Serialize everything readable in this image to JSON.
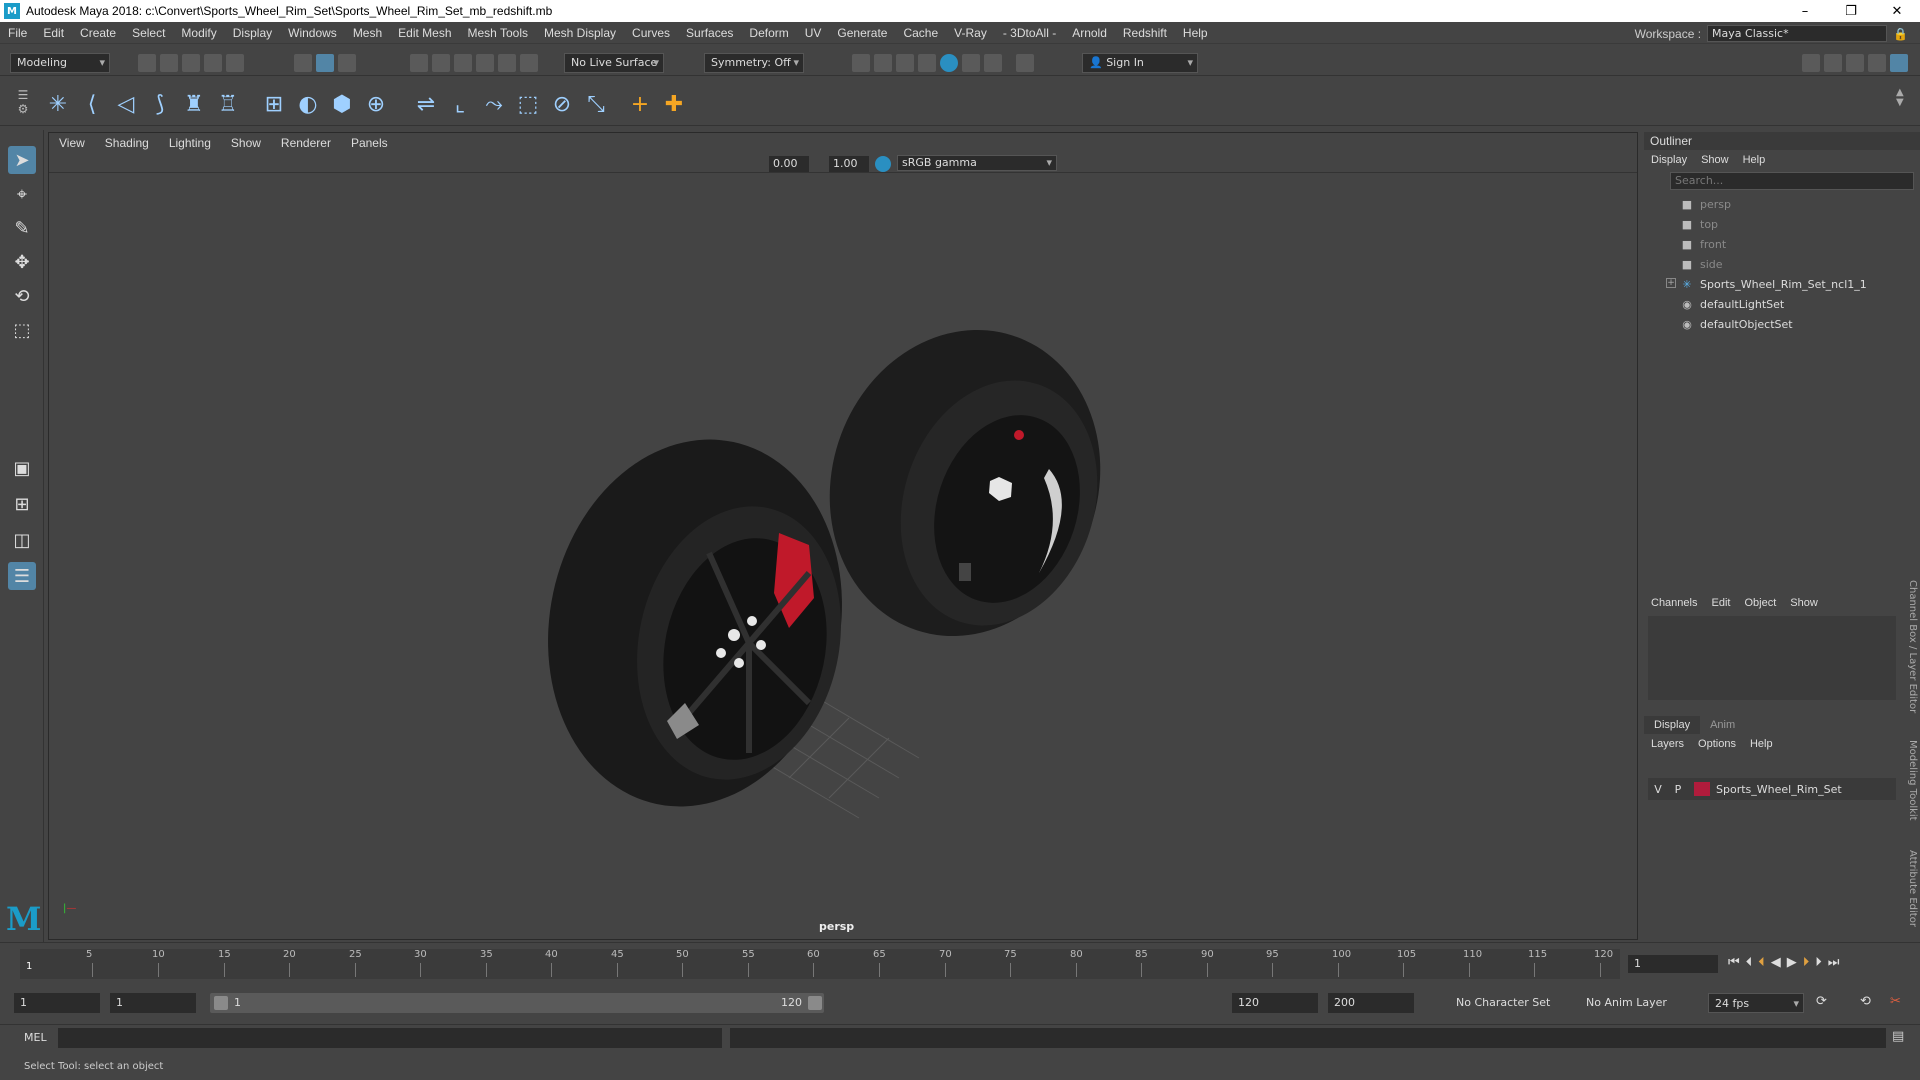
{
  "window": {
    "title": "Autodesk Maya 2018: c:\\Convert\\Sports_Wheel_Rim_Set\\Sports_Wheel_Rim_Set_mb_redshift.mb"
  },
  "menubar": {
    "items": [
      "File",
      "Edit",
      "Create",
      "Select",
      "Modify",
      "Display",
      "Windows",
      "Mesh",
      "Edit Mesh",
      "Mesh Tools",
      "Mesh Display",
      "Curves",
      "Surfaces",
      "Deform",
      "UV",
      "Generate",
      "Cache",
      "V-Ray",
      "- 3DtoAll -",
      "Arnold",
      "Redshift",
      "Help"
    ],
    "workspace_label": "Workspace :",
    "workspace_value": "Maya Classic*"
  },
  "statusline": {
    "mode": "Modeling",
    "live_surface": "No Live Surface",
    "symmetry": "Symmetry: Off",
    "sign_in": "Sign In"
  },
  "viewport": {
    "menu": [
      "View",
      "Shading",
      "Lighting",
      "Show",
      "Renderer",
      "Panels"
    ],
    "exposure": "0.00",
    "gamma": "1.00",
    "color_space": "sRGB gamma",
    "camera_label": "persp"
  },
  "outliner": {
    "title": "Outliner",
    "menu": [
      "Display",
      "Show",
      "Help"
    ],
    "search_placeholder": "Search...",
    "items": [
      {
        "label": "persp",
        "icon": "camera-icon",
        "dim": true
      },
      {
        "label": "top",
        "icon": "camera-icon",
        "dim": true
      },
      {
        "label": "front",
        "icon": "camera-icon",
        "dim": true
      },
      {
        "label": "side",
        "icon": "camera-icon",
        "dim": true
      },
      {
        "label": "Sports_Wheel_Rim_Set_ncl1_1",
        "icon": "group-icon",
        "dim": false
      },
      {
        "label": "defaultLightSet",
        "icon": "set-icon",
        "dim": false
      },
      {
        "label": "defaultObjectSet",
        "icon": "set-icon",
        "dim": false
      }
    ]
  },
  "channelbox": {
    "menu": [
      "Channels",
      "Edit",
      "Object",
      "Show"
    ]
  },
  "layers": {
    "tabs": [
      "Display",
      "Anim"
    ],
    "menu": [
      "Layers",
      "Options",
      "Help"
    ],
    "row": {
      "v": "V",
      "p": "P",
      "name": "Sports_Wheel_Rim_Set",
      "color": "#b01c3c"
    }
  },
  "sidetabs": [
    "Channel Box / Layer Editor",
    "Modeling Toolkit",
    "Attribute Editor"
  ],
  "timeline": {
    "ticks": [
      5,
      10,
      15,
      20,
      25,
      30,
      35,
      40,
      45,
      50,
      55,
      60,
      65,
      70,
      75,
      80,
      85,
      90,
      95,
      100,
      105,
      110,
      115,
      120
    ],
    "start_tick": "1",
    "current_frame": "1"
  },
  "range": {
    "start": "1",
    "playback_start": "1",
    "slider_start": "1",
    "slider_end": "120",
    "playback_end": "120",
    "end": "200",
    "character_set": "No Character Set",
    "anim_layer": "No Anim Layer",
    "fps": "24 fps"
  },
  "cmdline": {
    "label": "MEL"
  },
  "helpline": {
    "text": "Select Tool: select an object"
  }
}
